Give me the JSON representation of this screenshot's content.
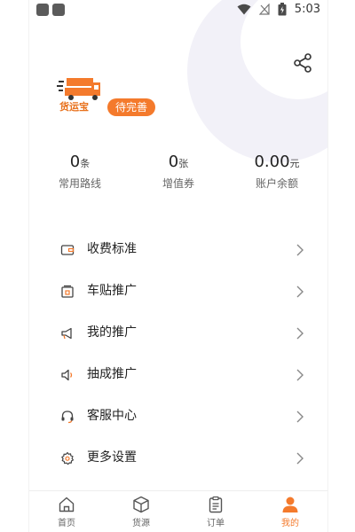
{
  "status_bar": {
    "time": "5:03"
  },
  "profile": {
    "logo_text": "货运宝",
    "badge": "待完善"
  },
  "stats": [
    {
      "value": "0",
      "unit": "条",
      "label": "常用路线"
    },
    {
      "value": "0",
      "unit": "张",
      "label": "增值券"
    },
    {
      "value": "0.00",
      "unit": "元",
      "label": "账户余额"
    }
  ],
  "menu": {
    "items": [
      {
        "label": "收费标准",
        "icon": "wallet-icon"
      },
      {
        "label": "车贴推广",
        "icon": "sticker-icon"
      },
      {
        "label": "我的推广",
        "icon": "megaphone-icon"
      },
      {
        "label": "抽成推广",
        "icon": "speaker-icon"
      },
      {
        "label": "客服中心",
        "icon": "headset-icon"
      },
      {
        "label": "更多设置",
        "icon": "gear-icon"
      }
    ]
  },
  "tabbar": {
    "items": [
      {
        "label": "首页",
        "icon": "home-icon"
      },
      {
        "label": "货源",
        "icon": "box-icon"
      },
      {
        "label": "订单",
        "icon": "clipboard-icon"
      },
      {
        "label": "我的",
        "icon": "person-icon"
      }
    ],
    "active_index": 3
  },
  "colors": {
    "accent": "#f47a2c",
    "deco": "#f2f1f8"
  }
}
